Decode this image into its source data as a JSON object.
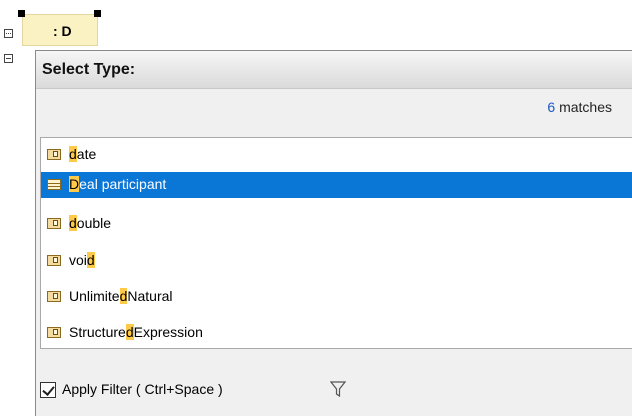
{
  "diagram": {
    "part_label": ": D"
  },
  "popup": {
    "title": "Select Type:",
    "matches_count": "6",
    "matches_suffix": " matches",
    "items": [
      {
        "pre": "",
        "hl": "d",
        "post": "ate",
        "icon": "datatype-icon",
        "selected": false
      },
      {
        "pre": "",
        "hl": "D",
        "post": "eal participant",
        "icon": "class-icon",
        "selected": true
      },
      {
        "pre": "",
        "hl": "d",
        "post": "ouble",
        "icon": "datatype-icon",
        "selected": false
      },
      {
        "pre": "voi",
        "hl": "d",
        "post": "",
        "icon": "datatype-icon",
        "selected": false
      },
      {
        "pre": "Unlimite",
        "hl": "d",
        "post": "Natural",
        "icon": "primitive-type-icon",
        "selected": false
      },
      {
        "pre": "Structure",
        "hl": "d",
        "post": "Expression",
        "icon": "primitive-type-icon",
        "selected": false
      }
    ],
    "filter_label": "Apply Filter ( Ctrl+Space )",
    "filter_checked": true
  }
}
